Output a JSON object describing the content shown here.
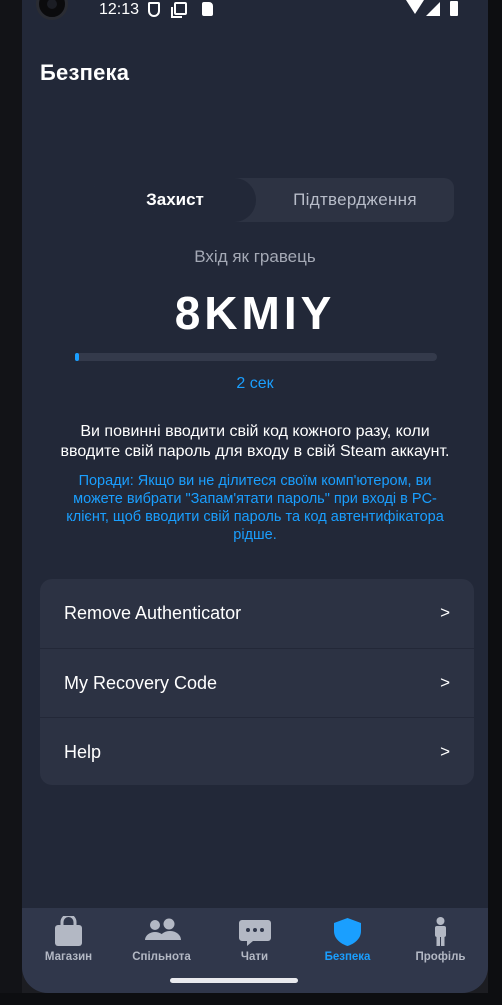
{
  "status_bar": {
    "time": "12:13"
  },
  "header": {
    "title": "Безпека"
  },
  "tabs": [
    {
      "label": "Захист",
      "active": true
    },
    {
      "label": "Підтвердження",
      "active": false
    }
  ],
  "guard": {
    "login_label": "Вхід як гравець",
    "code": "8KMIY",
    "progress_fraction": 0.01,
    "timer": "2 сек",
    "info_text": "Ви повинні вводити свій код кожного разу, коли вводите свій пароль для входу в свій Steam аккаунт.",
    "tip_text": "Поради: Якщо ви не ділитеся своїм комп'ютером, ви можете вибрати \"Запам'ятати пароль\" при вході в PC-клієнт, щоб вводити свій пароль та код автентифікатора рідше."
  },
  "menu": {
    "items": [
      {
        "label": "Remove Authenticator",
        "chevron": ">"
      },
      {
        "label": "My Recovery Code",
        "chevron": ">"
      },
      {
        "label": "Help",
        "chevron": ">"
      }
    ]
  },
  "bottom_nav": {
    "items": [
      {
        "label": "Магазин",
        "icon": "shopping-bag-icon"
      },
      {
        "label": "Спільнота",
        "icon": "community-icon"
      },
      {
        "label": "Чати",
        "icon": "chat-icon"
      },
      {
        "label": "Безпека",
        "icon": "shield-icon",
        "active": true
      },
      {
        "label": "Профіль",
        "icon": "profile-icon"
      }
    ]
  },
  "colors": {
    "background": "#222838",
    "card": "#2c3243",
    "accent": "#1a9fff",
    "nav_background": "#30374b"
  }
}
